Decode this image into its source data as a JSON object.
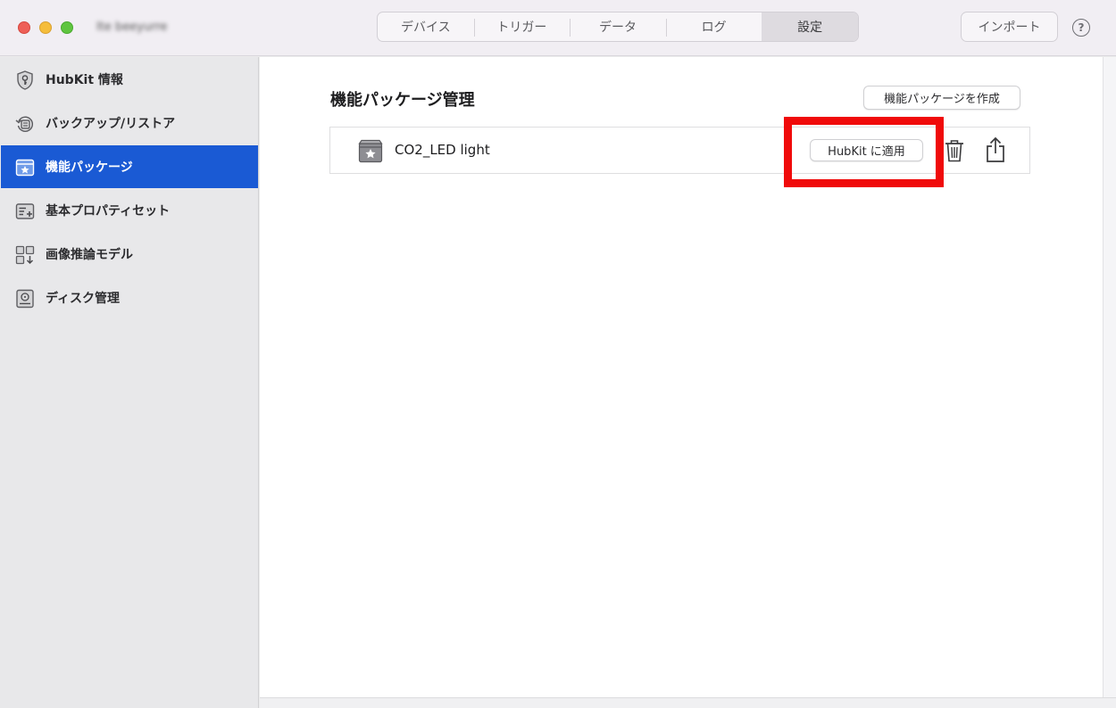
{
  "window": {
    "title": "Ite beeyurre"
  },
  "colors": {
    "accent": "#1a5ad4",
    "highlight": "#f00a0a"
  },
  "tabs": [
    {
      "label": "デバイス",
      "active": false
    },
    {
      "label": "トリガー",
      "active": false
    },
    {
      "label": "データ",
      "active": false
    },
    {
      "label": "ログ",
      "active": false
    },
    {
      "label": "設定",
      "active": true
    }
  ],
  "toolbar": {
    "import_label": "インポート",
    "help_label": "?"
  },
  "sidebar": {
    "items": [
      {
        "label": "HubKit 情報",
        "icon": "shield-key-icon",
        "selected": false
      },
      {
        "label": "バックアップ/リストア",
        "icon": "backup-restore-icon",
        "selected": false
      },
      {
        "label": "機能パッケージ",
        "icon": "package-star-icon",
        "selected": true
      },
      {
        "label": "基本プロパティセット",
        "icon": "property-set-icon",
        "selected": false
      },
      {
        "label": "画像推論モデル",
        "icon": "grid-download-icon",
        "selected": false
      },
      {
        "label": "ディスク管理",
        "icon": "disk-icon",
        "selected": false
      }
    ]
  },
  "main": {
    "section_title": "機能パッケージ管理",
    "create_button_label": "機能パッケージを作成",
    "packages": [
      {
        "name": "CO2_LED light",
        "icon": "package-star-icon",
        "apply_label": "HubKit に適用",
        "delete_icon": "trash-icon",
        "export_icon": "share-icon"
      }
    ]
  }
}
